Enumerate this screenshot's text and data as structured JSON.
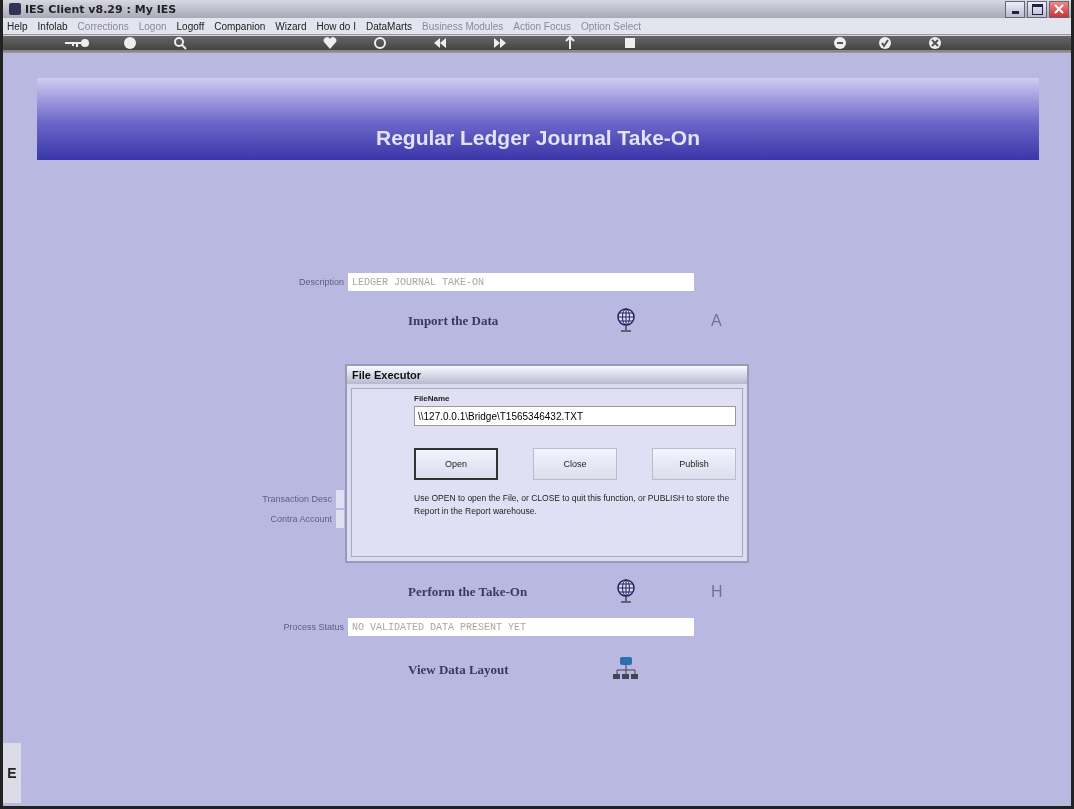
{
  "window": {
    "title": "IES Client v8.29 : My IES"
  },
  "menu": [
    {
      "label": "Help",
      "disabled": false
    },
    {
      "label": "Infolab",
      "disabled": false
    },
    {
      "label": "Corrections",
      "disabled": true
    },
    {
      "label": "Logon",
      "disabled": true
    },
    {
      "label": "Logoff",
      "disabled": false
    },
    {
      "label": "Companion",
      "disabled": false
    },
    {
      "label": "Wizard",
      "disabled": false
    },
    {
      "label": "How do I",
      "disabled": false
    },
    {
      "label": "DataMarts",
      "disabled": false
    },
    {
      "label": "Business Modules",
      "disabled": true
    },
    {
      "label": "Action Focus",
      "disabled": true
    },
    {
      "label": "Option Select",
      "disabled": true
    }
  ],
  "page_title": "Regular Ledger Journal Take-On",
  "form": [
    {
      "kind": "field",
      "label": "Description",
      "value": "LEDGER JOURNAL TAKE-ON"
    },
    {
      "kind": "globe_action",
      "label": "Import the Data",
      "key": "A"
    },
    {
      "kind": "hidden",
      "label": "Transaction Desc"
    },
    {
      "kind": "hidden",
      "label": "Contra Account"
    },
    {
      "kind": "globe_action",
      "label": "Perform the Take-On",
      "key": "H"
    },
    {
      "kind": "field",
      "label": "Process Status",
      "value": "NO VALIDATED DATA PRESENT YET"
    },
    {
      "kind": "layout_action",
      "label": "View Data Layout"
    }
  ],
  "dialog": {
    "title": "File Executor",
    "field_label": "FileName",
    "file_name": "\\\\127.0.0.1\\Bridge\\T1565346432.TXT",
    "buttons": [
      {
        "label": "Open",
        "selected": true
      },
      {
        "label": "Close",
        "selected": false
      },
      {
        "label": "Publish",
        "selected": false
      }
    ],
    "help": "Use OPEN to open the File, or CLOSE to quit this function, or PUBLISH to store the Report in the Report warehouse."
  },
  "side_tab": "E"
}
